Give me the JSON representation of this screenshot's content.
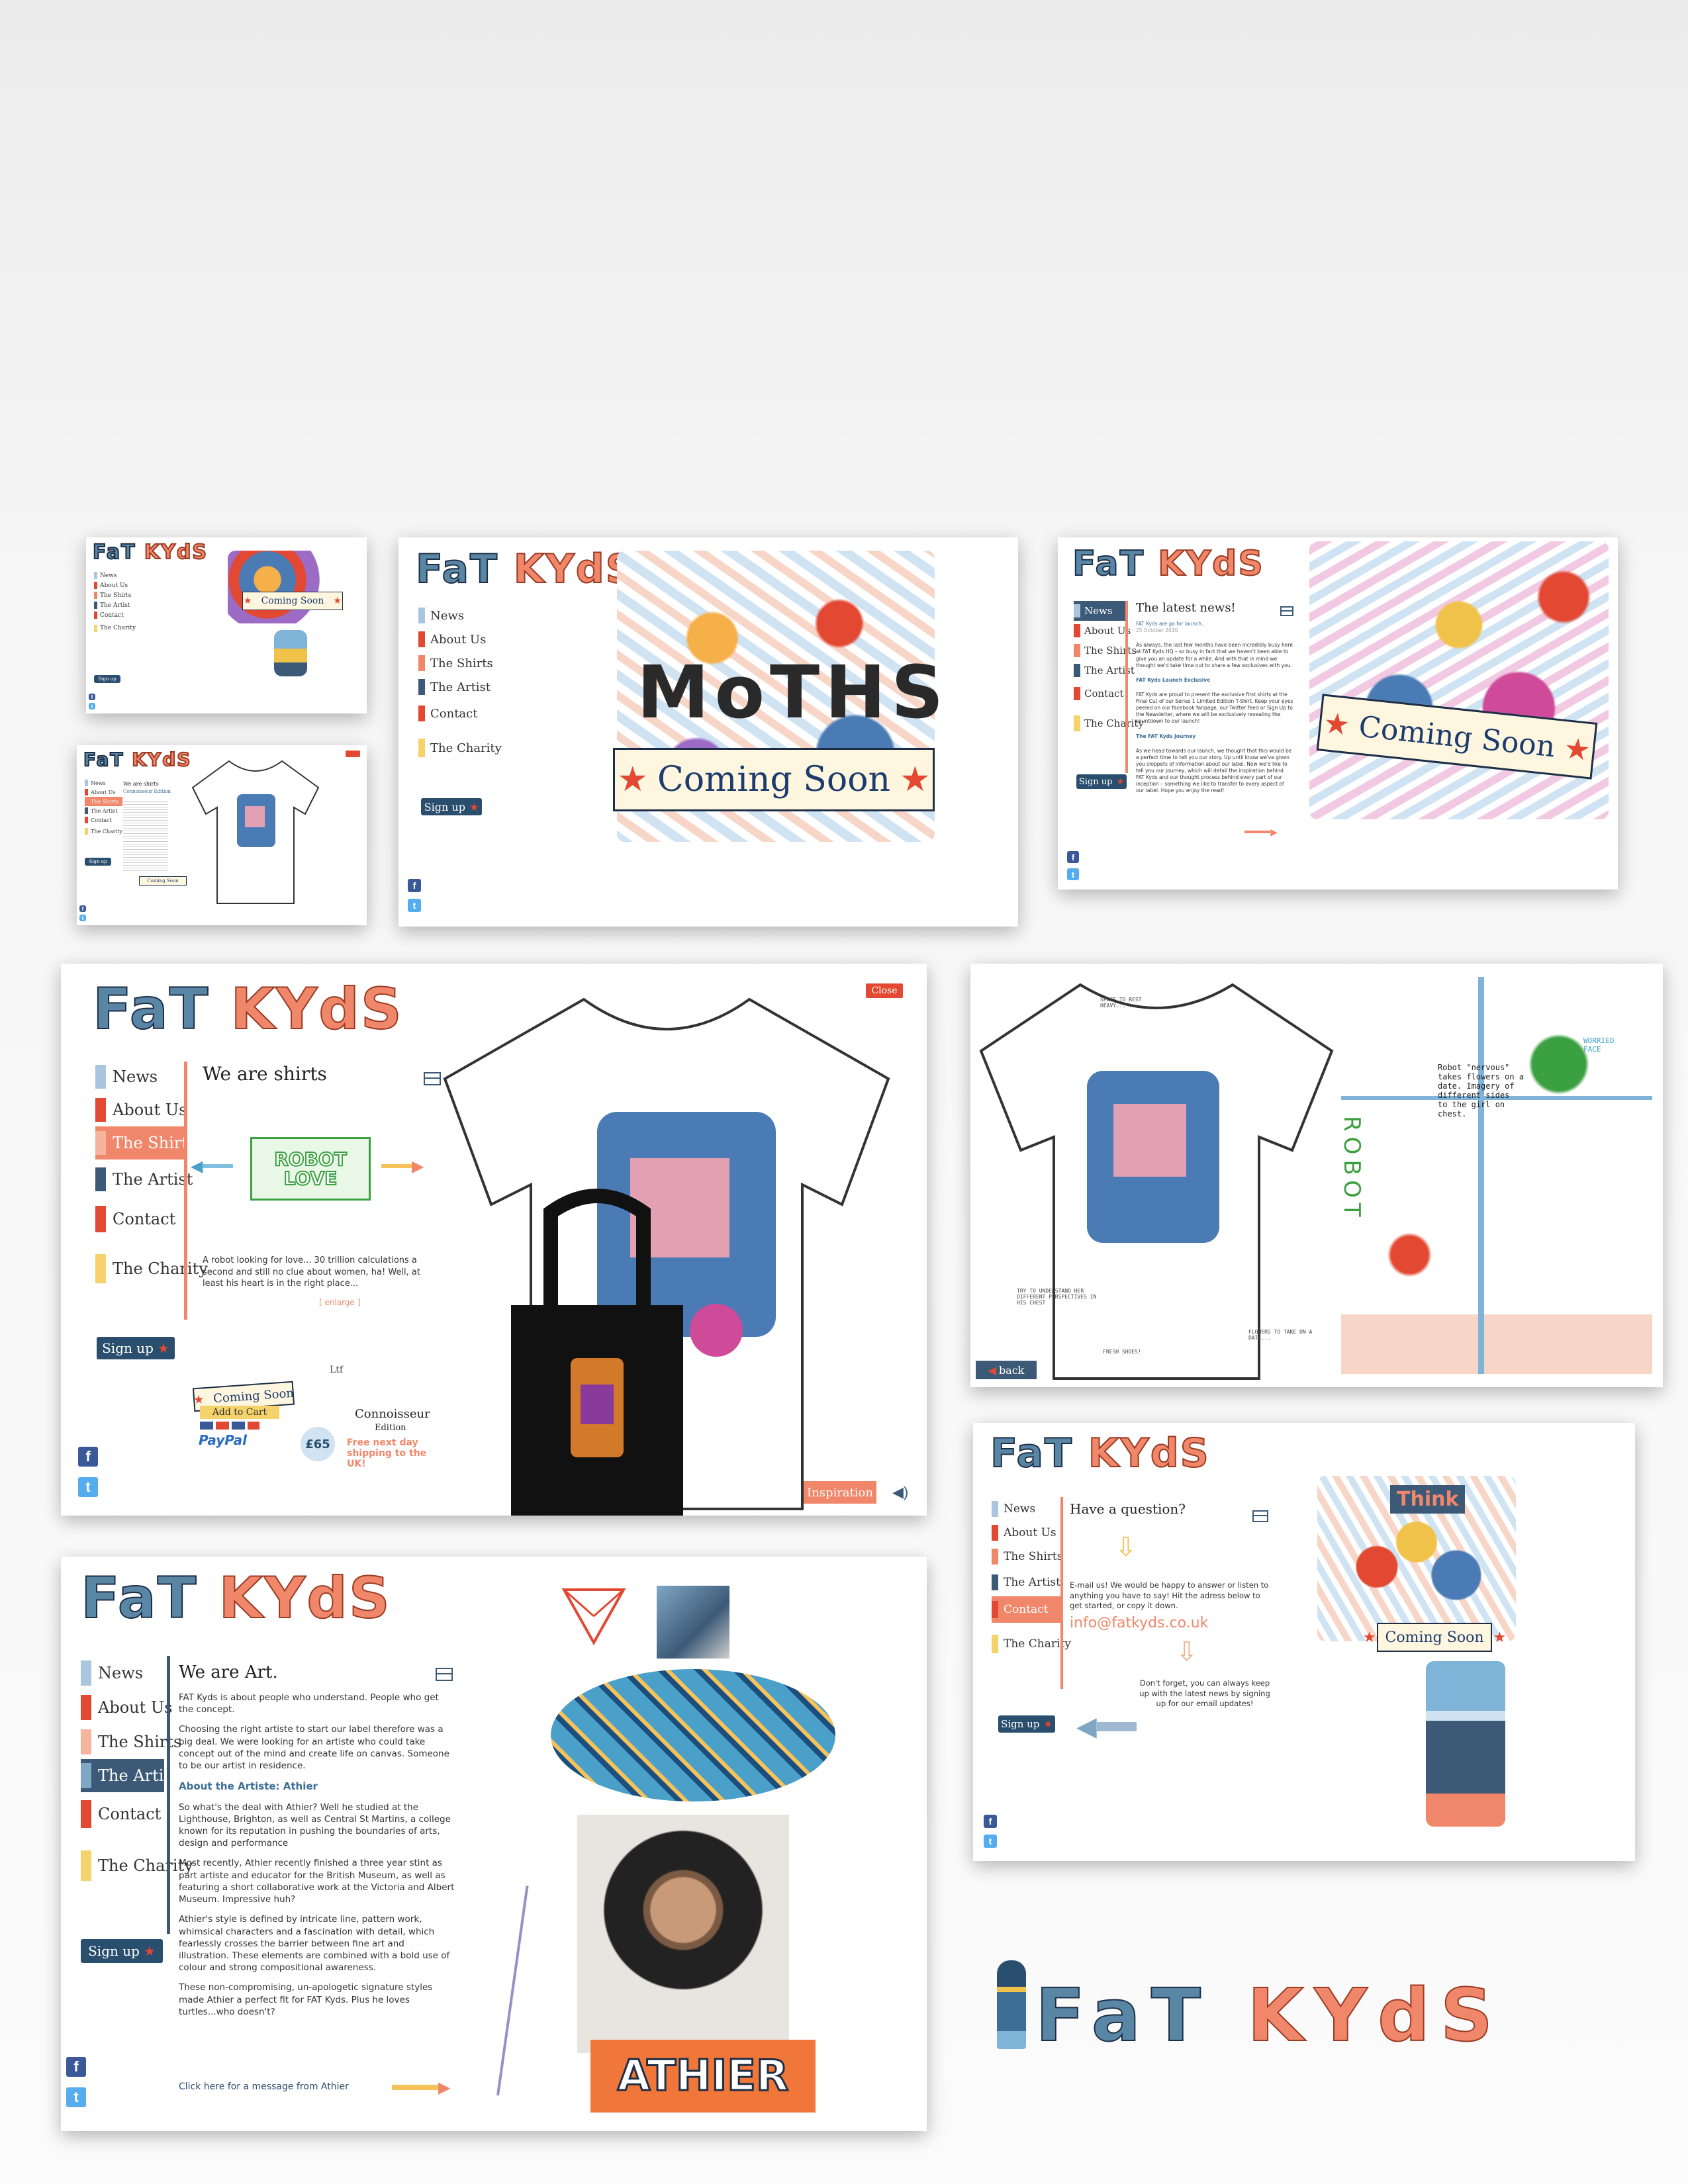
{
  "brand": {
    "fat": "FaT",
    "kyds": "KYdS"
  },
  "nav": {
    "news": "News",
    "about": "About Us",
    "shirts": "The Shirts",
    "artist": "The Artist",
    "contact": "Contact",
    "charity": "The Charity"
  },
  "signup": "Sign up",
  "social": {
    "facebook": "f",
    "twitter": "t"
  },
  "coming_soon": "Coming Soon",
  "moths": "MoTHS",
  "panel_news": {
    "heading": "The latest news!",
    "date": "FAT Kyds are go for launch...",
    "dateline": "25 October 2010",
    "p1": "As always, the last few months have been incredibly busy here at FAT Kyds HQ – so busy in fact that we haven't been able to give you an update for a while. And with that in mind we thought we'd take time out to share a few exclusives with you.",
    "sub1": "FAT Kyds Launch Exclusive",
    "p2": "FAT Kyds are proud to present the exclusive first shirts at the Final Cut of our Series 1 Limited Edition T-Shirt. Keep your eyes peeled on our facebook fanpage, our Twitter feed or Sign Up to the Newsletter, where we will be exclusively revealing the countdown to our launch!",
    "sub2": "The FAT Kyds Journey",
    "p3": "As we head towards our launch, we thought that this would be a perfect time to tell you our story. Up until know we've given you snippets of information about our label. Now we'd like to tell you our journey, which will detail the inspiration behind FAT Kyds and our thought process behind every part of our inception – something we like to transfer to every aspect of our label. Hope you enjoy the read!"
  },
  "panel_tiny_shirt": {
    "heading": "We are shirts",
    "edition": "Connoisseur Edition"
  },
  "panel_shirts": {
    "heading": "We are shirts",
    "design": "ROBOT LOVE",
    "desc": "A robot looking for love... 30 trillion calculations a second and still no clue about women, ha! Well, at least his heart is in the right place...",
    "enlarge": "[ enlarge ]",
    "close": "Close",
    "add_to_cart": "Add to Cart",
    "paypal": "PayPal",
    "price": "£65",
    "shipping": "Free next day shipping to the UK!",
    "edition_title": "Connoisseur",
    "edition_sub": "Edition",
    "inspiration": "Inspiration",
    "ltd": "Ltf"
  },
  "panel_sketch": {
    "back": "back",
    "robot": "ROBOT",
    "note_top": "SPACE TO REST\nHEAVY...",
    "note_right": "Robot \"nervous\"\ntakes flowers on a\ndate. Imagery of\ndifferent sides\nto the girl on\nchest.",
    "note_face": "WORRIED\nFACE",
    "note_left": "TRY TO UNDERSTAND HER\nDIFFERENT PERSPECTIVES IN\nHIS CHEST",
    "note_bottom": "FRESH SHOES!",
    "note_flowers": "FLOWERS TO TAKE ON A\nDATE..."
  },
  "panel_contact": {
    "heading": "Have a question?",
    "p1": "E-mail us! We would be happy to answer or listen to anything you have to say! Hit the adress below to get started, or copy it down.",
    "email": "info@fatkyds.co.uk",
    "p2": "Don't forget, you can always keep up with the latest news by signing up for our email updates!",
    "sign_text": "Think"
  },
  "panel_art": {
    "heading": "We are Art.",
    "p1": "FAT Kyds is about people who understand. People who get the concept.",
    "p2": "Choosing the right artiste to start our label therefore was a big deal. We were looking for an artiste who could take concept out of the mind and create life on canvas. Someone to be our artist in residence.",
    "sub": "About the Artiste: Athier",
    "p3": "So what's the deal with Athier? Well he studied at the Lighthouse, Brighton, as well as Central St Martins, a college known for its reputation in pushing the boundaries of arts, design and performance",
    "p4": "Most recently, Athier recently finished a three year stint as part artiste and educator for the British Museum, as well as featuring a short collaborative work at the Victoria and Albert Museum. Impressive huh?",
    "p5": "Athier's style is defined by intricate line, pattern work, whimsical characters and a fascination with detail, which fearlessly crosses the barrier between fine art and illustration. These elements are combined with a bold use of colour and strong compositional awareness.",
    "p6": "These non-compromising, un-apologetic signature styles made Athier a perfect fit for FAT Kyds. Plus he loves turtles...who doesn't?",
    "link": "Click here for a message from Athier",
    "name": "ATHIER"
  },
  "colors": {
    "accent": "#f0876a",
    "navy": "#1c2e46",
    "blue": "#3c5a78",
    "red": "#e24832",
    "facebook": "#3b5998",
    "twitter": "#55acee"
  }
}
